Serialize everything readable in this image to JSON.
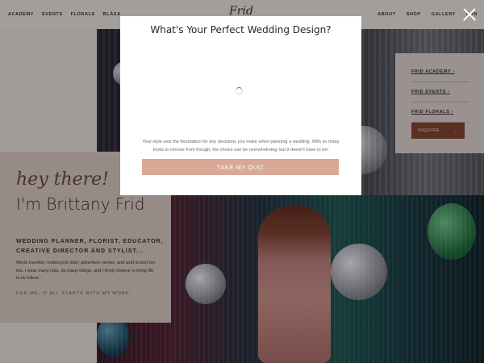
{
  "nav": {
    "left_links": [
      "ACADEMY",
      "EVENTS",
      "FLORALS",
      "BLĀSA"
    ],
    "logo": "Frid",
    "right_links": [
      "ABOUT",
      "SHOP",
      "GALLERY",
      "CON"
    ]
  },
  "intro": {
    "greeting": "hey there!",
    "name": "I'm Brittany Frid",
    "roles": "WEDDING PLANNER, FLORIST, EDUCATOR, CREATIVE DIRECTOR AND STYLIST...",
    "bio": "World traveller, motorcycle rider, adventure seeker, and avid scotch fan too. I wear many hats, do many things, and I firmly believe in living life to its fullest.",
    "tagline": "FOR ME, IT ALL STARTS WITH MY WORK."
  },
  "sidebar": {
    "items": [
      "FRID ACADEMY ›",
      "FRID EVENTS ›",
      "FRID FLORALS ›"
    ],
    "inquire_label": "INQUIRE",
    "inquire_chevron": "⌄"
  },
  "modal": {
    "title": "What's Your Perfect Wedding Design?",
    "description": "Your style sets the foundation for any decisions you make when planning a wedding. With so many looks to choose from though, the choice can be overwhelming, but it doesn't have to be!",
    "button_label": "TAKE MY QUIZ"
  },
  "icons": {
    "close": "close-icon",
    "spinner": "loading-spinner-icon"
  },
  "colors": {
    "quiz_button": "#d9a897",
    "inquire_button": "#8b4a36",
    "overlay": "rgba(0,0,0,0.35)"
  }
}
